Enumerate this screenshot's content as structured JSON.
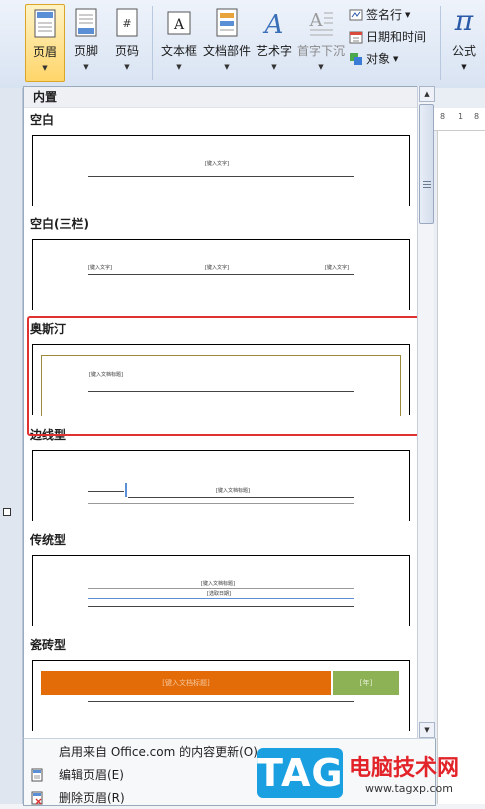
{
  "ribbon": {
    "buttons": [
      {
        "label": "页眉",
        "arrow": "▼"
      },
      {
        "label": "页脚",
        "arrow": "▼"
      },
      {
        "label": "页码",
        "arrow": "▼"
      },
      {
        "label": "文本框",
        "arrow": "▼"
      },
      {
        "label": "文档部件",
        "arrow": "▼"
      },
      {
        "label": "艺术字",
        "arrow": "▼"
      },
      {
        "label": "首字下沉",
        "arrow": "▼"
      }
    ],
    "small": [
      {
        "label": "签名行",
        "arrow": "▼"
      },
      {
        "label": "日期和时间"
      },
      {
        "label": "对象",
        "arrow": "▼"
      }
    ],
    "equation": {
      "symbol": "π",
      "label": "公式",
      "arrow": "▼"
    }
  },
  "gallery": {
    "section_header": "内置",
    "items": [
      {
        "title": "空白",
        "placeholders": [
          "[键入文字]"
        ]
      },
      {
        "title": "空白(三栏)",
        "placeholders": [
          "[键入文字]",
          "[键入文字]",
          "[键入文字]"
        ]
      },
      {
        "title": "奥斯汀",
        "placeholders": [
          "[键入文档标题]"
        ]
      },
      {
        "title": "边线型",
        "placeholders": [
          "[键入文档标题]"
        ]
      },
      {
        "title": "传统型",
        "placeholders": [
          "[键入文档标题]",
          "[选取日期]"
        ]
      },
      {
        "title": "瓷砖型",
        "placeholders": [
          "[键入文档标题]",
          "[年]"
        ]
      }
    ]
  },
  "menu": {
    "items": [
      {
        "label": "启用来自 Office.com 的内容更新(O)..."
      },
      {
        "label": "编辑页眉(E)"
      },
      {
        "label": "删除页眉(R)"
      }
    ]
  },
  "ruler": {
    "ticks": [
      "8",
      "1",
      "8"
    ]
  },
  "watermark": {
    "logo": "TAG",
    "title": "电脑技术网",
    "url": "www.tagxp.com"
  },
  "colors": {
    "accent": "#e36c09",
    "tile_green": "#8db255",
    "highlight": "#e03030",
    "austin_border": "#9b8a3c"
  }
}
